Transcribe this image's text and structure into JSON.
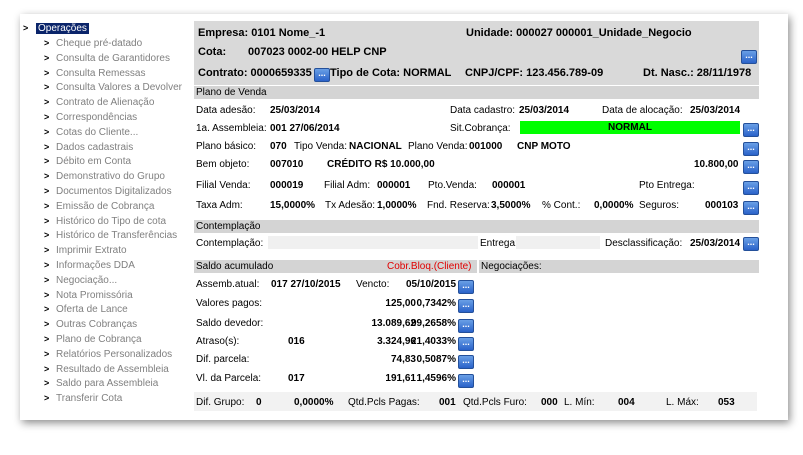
{
  "sidebar": {
    "root": "Operações",
    "items": [
      "Cheque pré-datado",
      "Consulta de Garantidores",
      "Consulta Remessas",
      "Consulta Valores a Devolver",
      "Contrato de Alienação",
      "Correspondências",
      "Cotas do Cliente...",
      "Dados cadastrais",
      "Débito em Conta",
      "Demonstrativo do Grupo",
      "Documentos Digitalizados",
      "Emissão de Cobrança",
      "Histórico do Tipo de cota",
      "Histórico de Transferências",
      "Imprimir Extrato",
      "Informações DDA",
      "Negociação...",
      "Nota Promissória",
      "Oferta de Lance",
      "Outras Cobranças",
      "Plano de Cobrança",
      "Relatórios Personalizados",
      "Resultado de Assembleia",
      "Saldo para Assembleia",
      "Transferir Cota"
    ]
  },
  "header": {
    "empresa": "Empresa: 0101 Nome_-1",
    "unidade": "Unidade: 000027 000001_Unidade_Negocio",
    "cota_label": "Cota:",
    "cota_value": "007023  0002-00  HELP CNP",
    "contrato": "Contrato: 0000659335",
    "tipo_cota": "Tipo de Cota: NORMAL",
    "cnpj": "CNPJ/CPF: 123.456.789-09",
    "dt_nasc": "Dt. Nasc.: 28/11/1978"
  },
  "plano_venda": {
    "section": "Plano de Venda",
    "data_adesao_label": "Data adesão:",
    "data_adesao": "25/03/2014",
    "data_cadastro_label": "Data cadastro:",
    "data_cadastro": "25/03/2014",
    "data_alocacao_label": "Data de alocação:",
    "data_alocacao": "25/03/2014",
    "assembleia_label": "1a. Assembleia:",
    "assembleia": "001  27/06/2014",
    "sit_cobranca_label": "Sit.Cobrança:",
    "sit_cobranca": "NORMAL",
    "plano_basico_label": "Plano básico:",
    "plano_basico": "070",
    "tipo_venda_label": "Tipo Venda:",
    "tipo_venda": "NACIONAL",
    "plano_venda_label": "Plano Venda:",
    "plano_venda_cod": "001000",
    "plano_venda_nome": "CNP MOTO",
    "bem_objeto_label": "Bem objeto:",
    "bem_objeto_cod": "007010",
    "bem_objeto_desc": "CRÉDITO R$ 10.000,00",
    "bem_objeto_valor": "10.800,00",
    "filial_venda_label": "Filial Venda:",
    "filial_venda": "000019",
    "filial_adm_label": "Filial Adm:",
    "filial_adm": "000001",
    "pto_venda_label": "Pto.Venda:",
    "pto_venda": "000001",
    "pto_entrega_label": "Pto Entrega:",
    "taxa_adm_label": "Taxa Adm:",
    "taxa_adm": "15,0000%",
    "tx_adesao_label": "Tx Adesão:",
    "tx_adesao": "1,0000%",
    "fnd_reserva_label": "Fnd. Reserva:",
    "fnd_reserva": "3,5000%",
    "pct_cont_label": "% Cont.:",
    "pct_cont": "0,0000%",
    "seguros_label": "Seguros:",
    "seguros": "000103"
  },
  "contemplacao": {
    "section": "Contemplação",
    "label": "Contemplação:",
    "entrega_label": "Entrega:",
    "desclassificacao_label": "Desclassificação:",
    "desclassificacao": "25/03/2014"
  },
  "saldo": {
    "section": "Saldo acumulado",
    "cobr_bloq": "Cobr.Bloq.(Cliente)",
    "negociacoes": "Negociações:",
    "assemb_atual_label": "Assemb.atual:",
    "assemb_atual": "017  27/10/2015",
    "vencto_label": "Vencto:",
    "vencto": "05/10/2015",
    "valores_pagos_label": "Valores pagos:",
    "valores_pagos": "125,00",
    "valores_pagos_pct": "0,7342%",
    "saldo_devedor_label": "Saldo devedor:",
    "saldo_devedor": "13.089,62",
    "saldo_devedor_pct": "99,2658%",
    "atrasos_label": "Atraso(s):",
    "atrasos_qtd": "016",
    "atrasos": "3.324,96",
    "atrasos_pct": "21,4033%",
    "dif_parcela_label": "Dif. parcela:",
    "dif_parcela": "74,83",
    "dif_parcela_pct": "0,5087%",
    "vl_parcela_label": "Vl. da Parcela:",
    "vl_parcela_qtd": "017",
    "vl_parcela": "191,61",
    "vl_parcela_pct": "1,4596%"
  },
  "footer": {
    "dif_grupo_label": "Dif. Grupo:",
    "dif_grupo": "0",
    "dif_grupo_pct": "0,0000%",
    "qtd_pagas_label": "Qtd.Pcls Pagas:",
    "qtd_pagas": "001",
    "qtd_furo_label": "Qtd.Pcls Furo:",
    "qtd_furo": "000",
    "l_min_label": "L. Mín:",
    "l_min": "004",
    "l_max_label": "L. Máx:",
    "l_max": "053"
  },
  "icons": {
    "ellipsis": "..."
  }
}
